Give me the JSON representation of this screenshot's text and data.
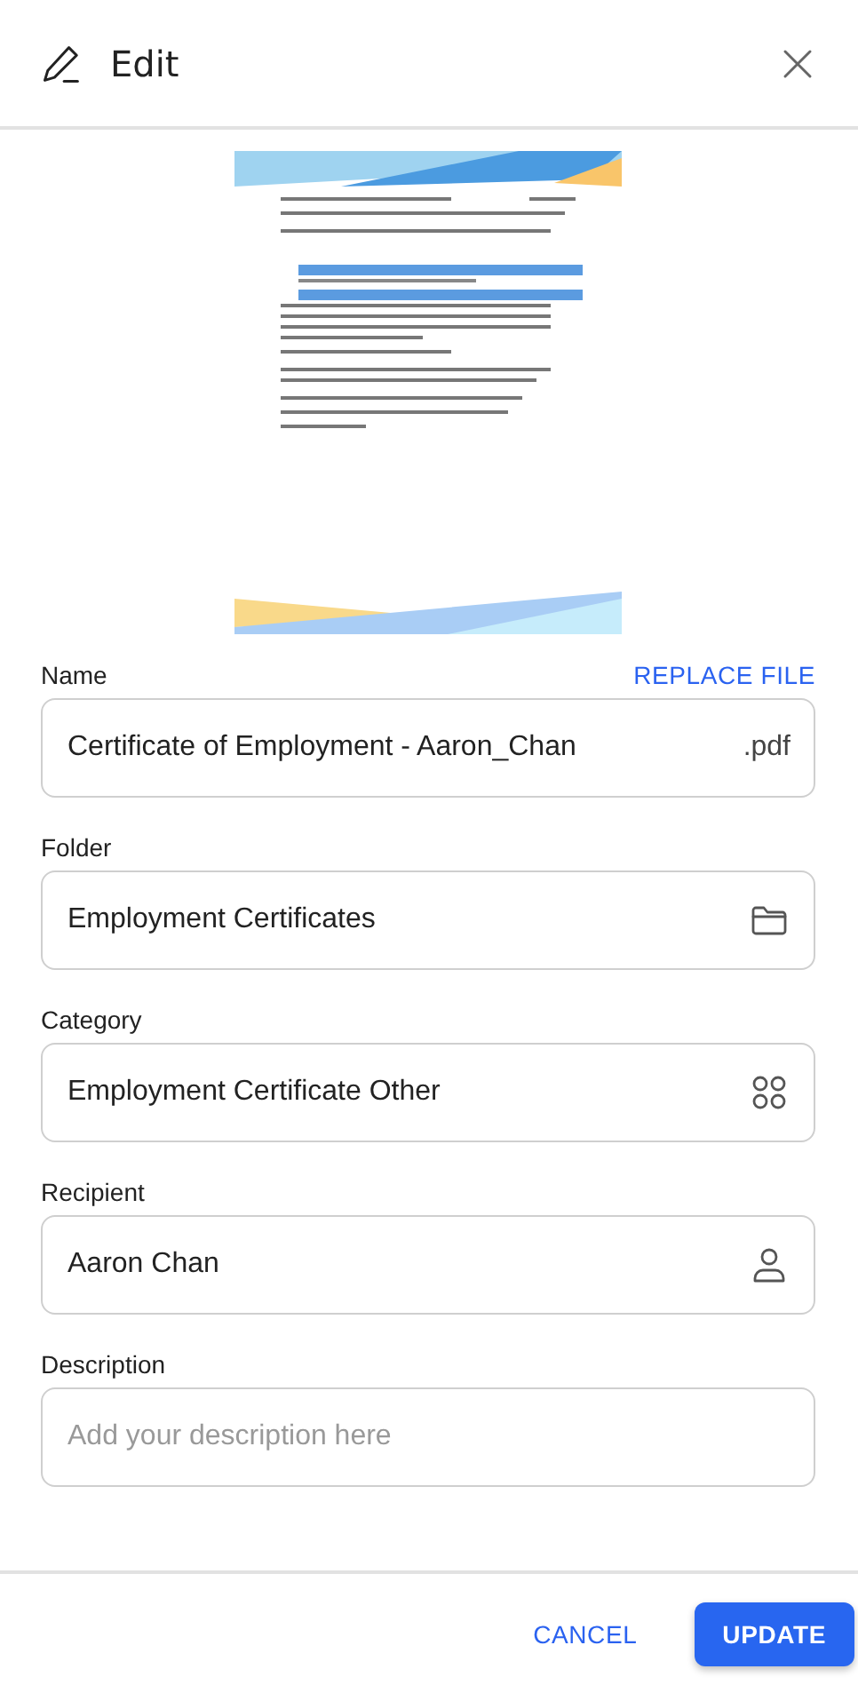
{
  "header": {
    "title": "Edit"
  },
  "replace_link": "REPLACE FILE",
  "fields": [
    {
      "label": "Name",
      "value": "Certificate of Employment - Aaron_Chan",
      "suffix": ".pdf",
      "kind": "suffix"
    },
    {
      "label": "Folder",
      "value": "Employment Certificates",
      "kind": "folder"
    },
    {
      "label": "Category",
      "value": "Employment Certificate Other",
      "kind": "grid"
    },
    {
      "label": "Recipient",
      "value": "Aaron Chan",
      "kind": "person"
    },
    {
      "label": "Description",
      "placeholder": "Add your description here",
      "kind": "plain"
    }
  ],
  "footer": {
    "buttons": [
      {
        "label": "CANCEL",
        "kind": "text"
      },
      {
        "label": "UPDATE",
        "kind": "primary"
      }
    ]
  }
}
